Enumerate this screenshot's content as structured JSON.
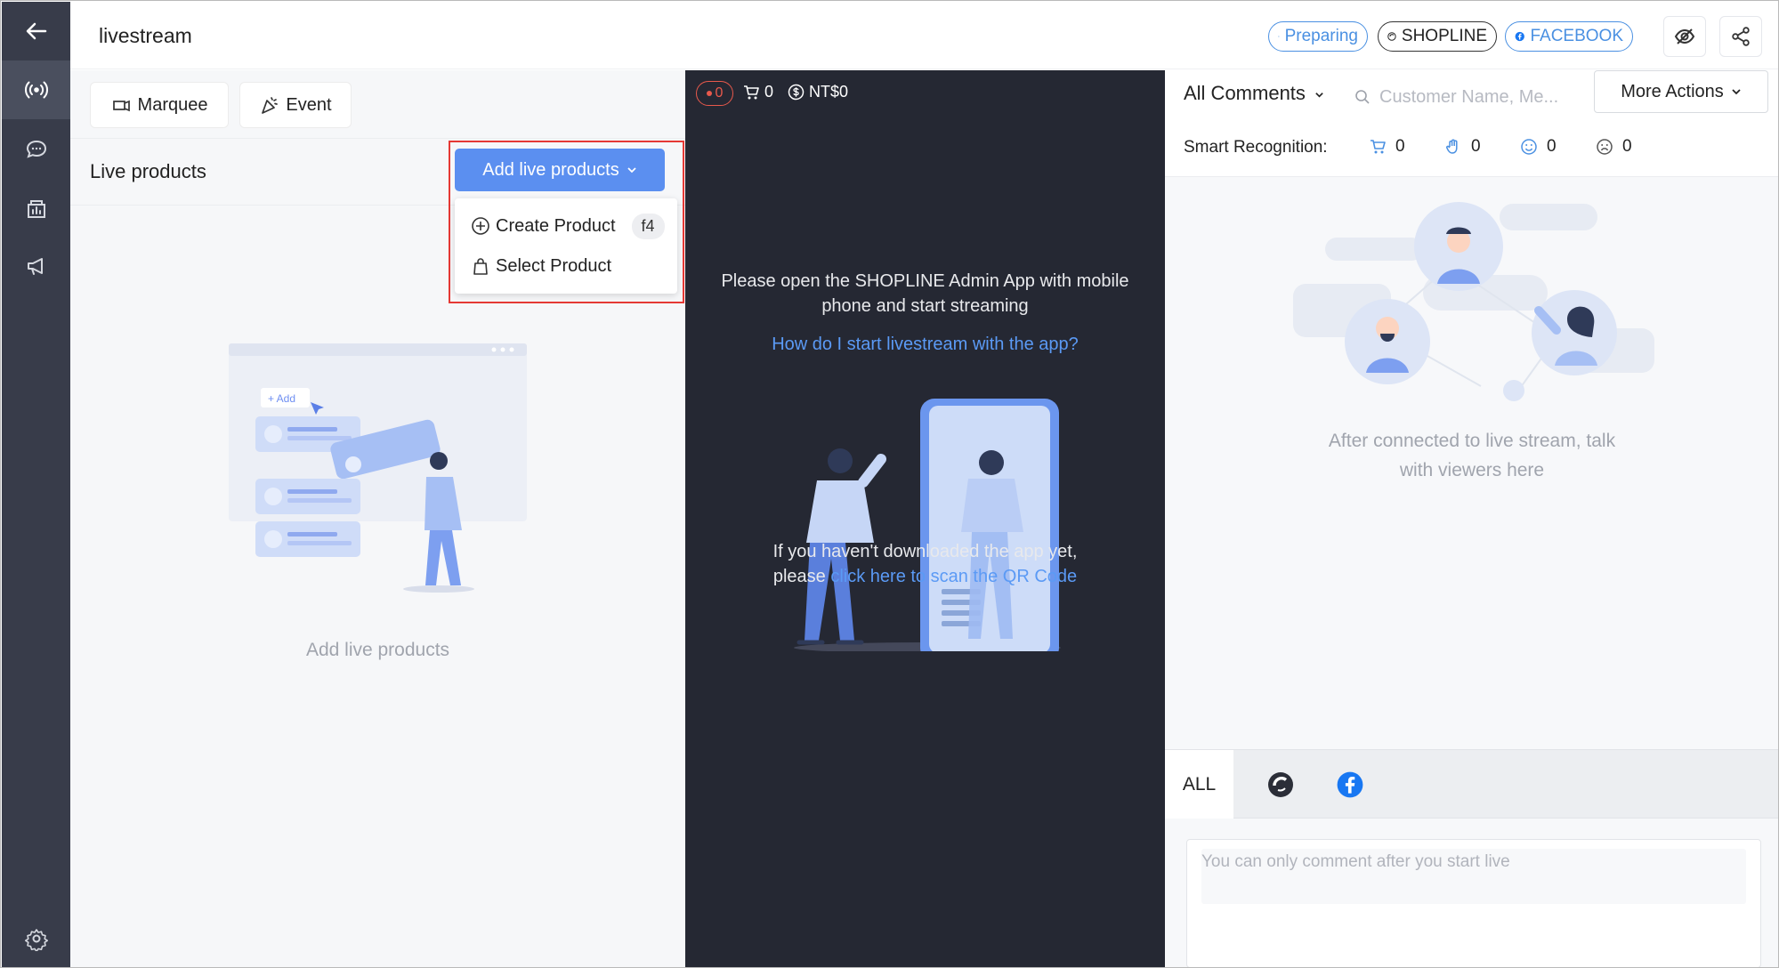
{
  "header": {
    "title": "livestream",
    "status_pill": "Preparing",
    "shopline_pill": "SHOPLINE",
    "facebook_pill": "FACEBOOK"
  },
  "sidebar": {
    "items": [
      {
        "icon": "back-arrow-icon"
      },
      {
        "icon": "broadcast-icon",
        "active": true
      },
      {
        "icon": "chat-bubble-icon"
      },
      {
        "icon": "store-analytics-icon"
      },
      {
        "icon": "megaphone-icon"
      },
      {
        "icon": "gear-icon"
      }
    ]
  },
  "left_panel": {
    "marquee_label": "Marquee",
    "event_label": "Event",
    "title": "Live products",
    "add_button_label": "Add live products",
    "menu": [
      {
        "label": "Create Product",
        "shortcut": "f4",
        "icon": "plus-circle-icon"
      },
      {
        "label": "Select Product",
        "icon": "shopping-bag-icon"
      }
    ],
    "illustration_add_label": "+ Add",
    "empty_label": "Add live products"
  },
  "stream_panel": {
    "live_count": "0",
    "cart_count": "0",
    "revenue": "NT$0",
    "instruction": [
      "Please open the SHOPLINE Admin App with mobile",
      "phone and start streaming"
    ],
    "help_link": "How do I start livestream with the app?",
    "download_line1": "If you haven't downloaded the app yet,",
    "download_prefix": "please ",
    "qr_link": "click here to scan the QR Code"
  },
  "comments_panel": {
    "filter_label": "All Comments",
    "search_placeholder": "Customer Name, Me...",
    "more_actions_label": "More Actions",
    "smart_recognition_label": "Smart Recognition:",
    "recognition": [
      {
        "icon": "cart-icon",
        "count": "0"
      },
      {
        "icon": "hand-icon",
        "count": "0"
      },
      {
        "icon": "smile-icon",
        "count": "0"
      },
      {
        "icon": "frown-icon",
        "count": "0"
      }
    ],
    "empty_line1": "After connected to live stream, talk",
    "empty_line2": "with viewers here",
    "tabs": [
      {
        "label": "ALL"
      },
      {
        "icon": "shopline-icon"
      },
      {
        "icon": "facebook-icon"
      }
    ],
    "comment_placeholder": "You can only comment after you start live"
  },
  "colors": {
    "accent": "#5b8ff0",
    "rail": "#383c4a",
    "stream_bg": "#252833",
    "link": "#5b9af5",
    "highlight": "#e53935"
  }
}
